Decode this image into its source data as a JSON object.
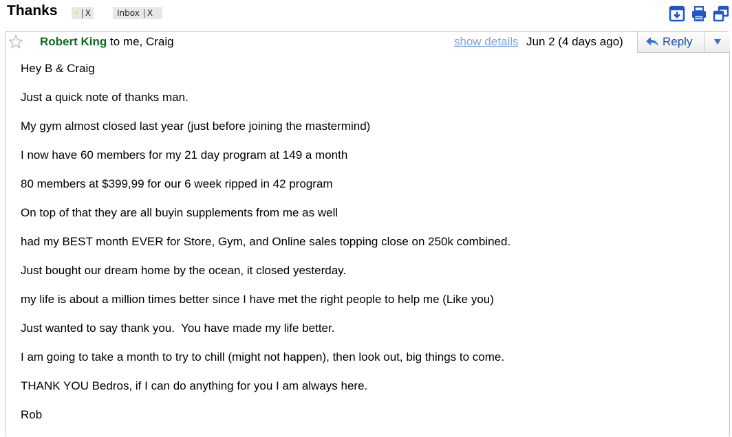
{
  "thread": {
    "subject": "Thanks",
    "labels": [
      {
        "icon": "label-tag-icon",
        "text": "",
        "remove": "X"
      },
      {
        "icon": "",
        "text": "Inbox",
        "remove": "X"
      }
    ]
  },
  "toolbar_icons": [
    "archive-icon",
    "print-icon",
    "new-window-icon"
  ],
  "message": {
    "sender": "Robert King",
    "recipients": "to me, Craig",
    "show_details": "show details",
    "date": "Jun 2 (4 days ago)",
    "reply_label": "Reply",
    "body": [
      "Hey B & Craig",
      "Just a quick note of thanks man.",
      "My gym almost closed last year (just before joining the mastermind)",
      "I now have 60 members for my 21 day program at 149 a month",
      "80 members at $399,99 for our 6 week ripped in 42 program",
      "On top of that they are all buyin supplements from me as well",
      "had my BEST month EVER for Store, Gym, and Online sales topping close on 250k combined.",
      "Just bought our dream home by the ocean, it closed yesterday.",
      "my life is about a million times better since I have met the right people to help me (Like you)",
      "Just wanted to say thank you.  You have made my life better.",
      "I am going to take a month to try to chill (might not happen), then look out, big things to come.",
      "THANK YOU Bedros, if I can do anything for you I am always here.",
      "Rob"
    ]
  },
  "colors": {
    "sender": "#0a6b1f",
    "link": "#7ea3d9",
    "reply": "#1a4fa6",
    "icon_blue": "#1f56c9"
  }
}
